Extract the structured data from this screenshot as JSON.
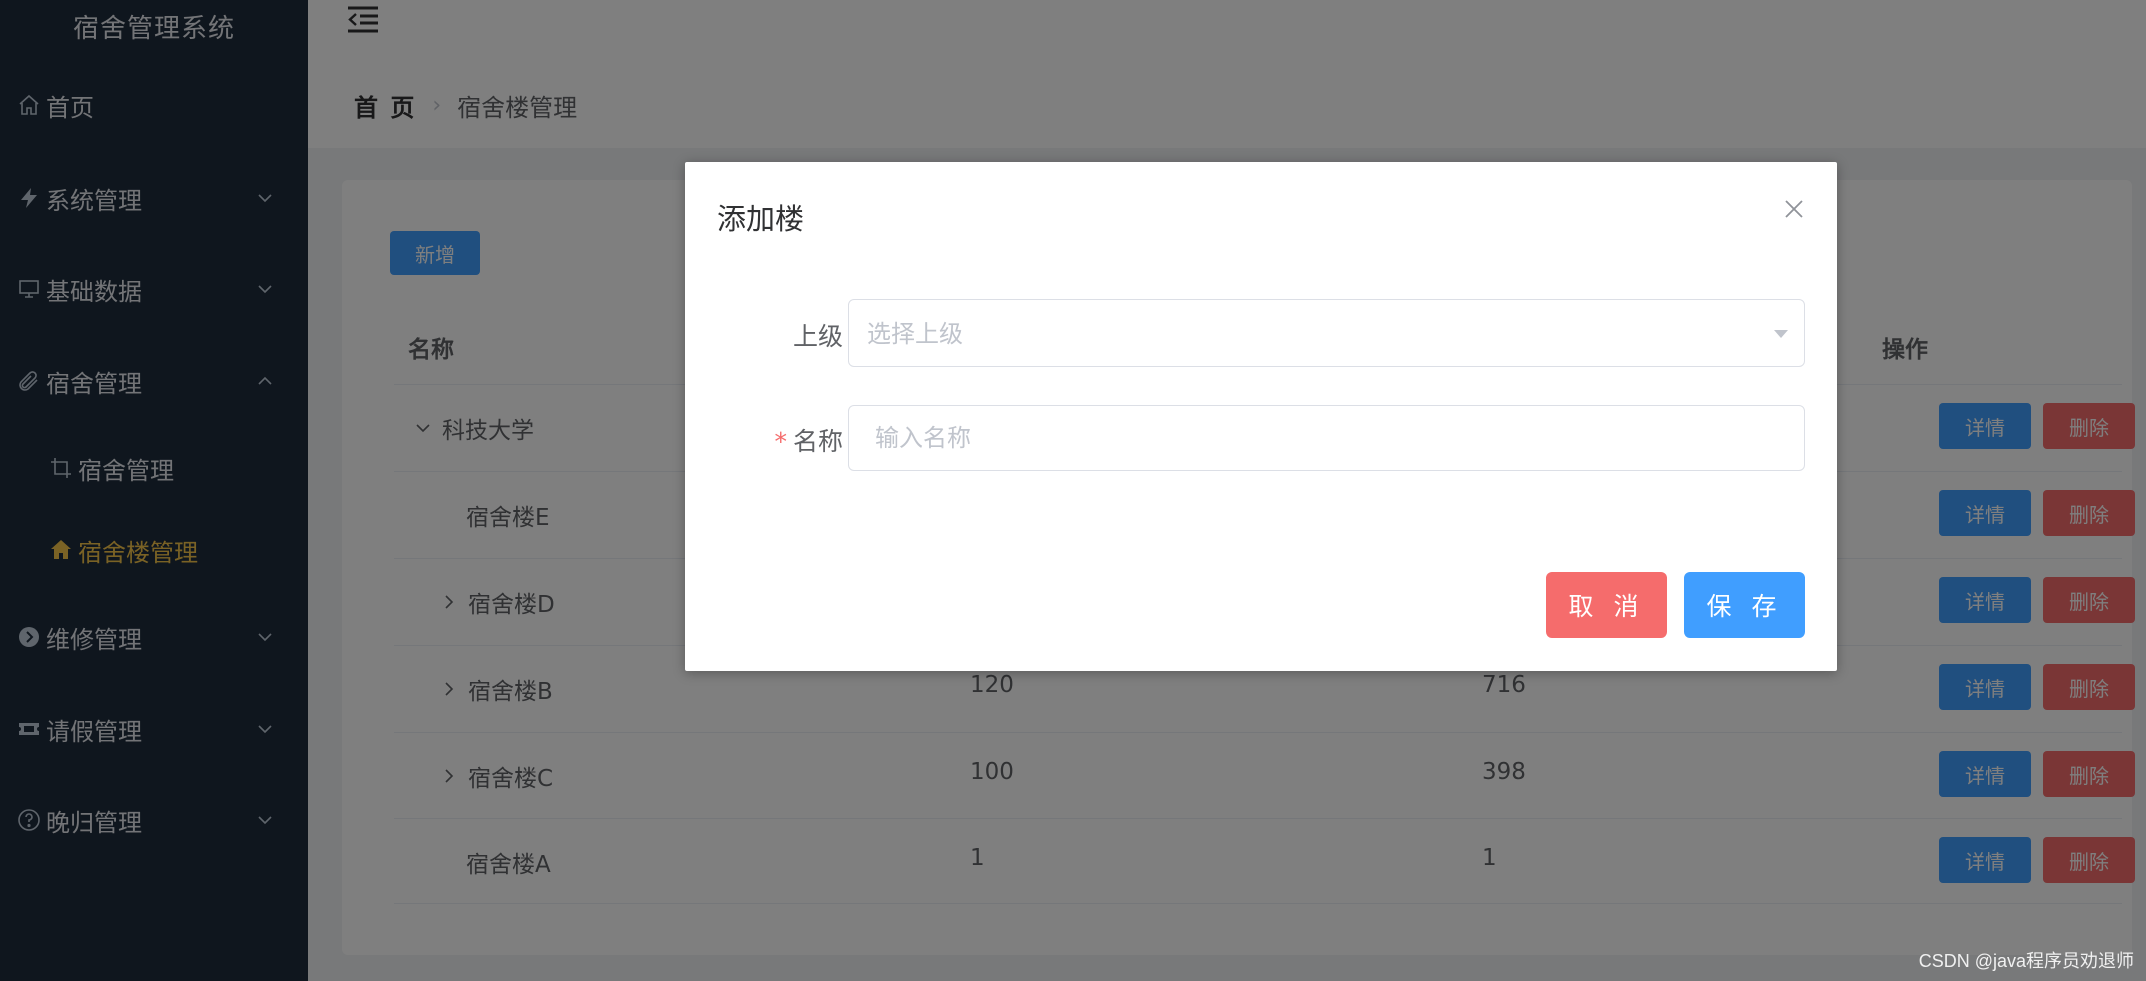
{
  "sidebar": {
    "brand": "宿舍管理系统",
    "items": [
      {
        "label": "首页",
        "icon": "home-icon"
      },
      {
        "label": "系统管理",
        "icon": "lightning-icon"
      },
      {
        "label": "基础数据",
        "icon": "monitor-icon"
      },
      {
        "label": "宿舍管理",
        "icon": "paperclip-icon"
      },
      {
        "label": "宿舍管理",
        "icon": "crop-icon"
      },
      {
        "label": "宿舍楼管理",
        "icon": "house-icon"
      },
      {
        "label": "维修管理",
        "icon": "circle-arrow-icon"
      },
      {
        "label": "请假管理",
        "icon": "ticket-icon"
      },
      {
        "label": "晚归管理",
        "icon": "question-icon"
      }
    ]
  },
  "header": {
    "breadcrumb_home": "首 页",
    "breadcrumb_current": "宿舍楼管理"
  },
  "toolbar": {
    "add_label": "新增"
  },
  "table": {
    "col_name": "名称",
    "col_ops": "操作",
    "detail_label": "详情",
    "delete_label": "删除",
    "rows": [
      {
        "name": "科技大学",
        "c2": "",
        "c3": ""
      },
      {
        "name": "宿舍楼E",
        "c2": "",
        "c3": ""
      },
      {
        "name": "宿舍楼D",
        "c2": "",
        "c3": ""
      },
      {
        "name": "宿舍楼B",
        "c2": "120",
        "c3": "716"
      },
      {
        "name": "宿舍楼C",
        "c2": "100",
        "c3": "398"
      },
      {
        "name": "宿舍楼A",
        "c2": "1",
        "c3": "1"
      }
    ]
  },
  "dialog": {
    "title": "添加楼",
    "parent_label": "上级",
    "parent_placeholder": "选择上级",
    "name_required_mark": "*",
    "name_label": "名称",
    "name_placeholder": "输入名称",
    "cancel_label": "取 消",
    "save_label": "保 存"
  },
  "watermark": "CSDN @java程序员劝退师",
  "colors": {
    "sidebar_bg": "#1f2d3d",
    "primary": "#409eff",
    "danger": "#f56c6c",
    "active_menu": "#f5c54a"
  }
}
